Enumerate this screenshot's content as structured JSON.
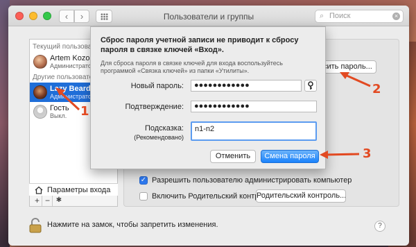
{
  "window": {
    "title": "Пользователи и группы",
    "search_placeholder": "Поиск"
  },
  "sidebar": {
    "current_section": "Текущий пользовате...",
    "current_user": {
      "name": "Artem Kozoriz",
      "role": "Администратор"
    },
    "other_section": "Другие пользовател...",
    "other_users": [
      {
        "name": "Lazy Beard",
        "role": "Администратор",
        "selected": true
      },
      {
        "name": "Гость",
        "role": "Выкл."
      }
    ],
    "login_options_label": "Параметры входа",
    "add_label": "+",
    "remove_label": "−",
    "gear_label": "✱"
  },
  "panel": {
    "reset_password_button": "сить пароль...",
    "allow_admin_label": "Разрешить пользователю администрировать компьютер",
    "allow_admin_checked": true,
    "parental_label": "Включить Родительский контроль",
    "parental_checked": false,
    "parental_button": "Родительский контроль..."
  },
  "footer": {
    "lock_text": "Нажмите на замок, чтобы запретить изменения.",
    "help_label": "?"
  },
  "sheet": {
    "title": "Сброс пароля учетной записи не приводит к сбросу пароля в связке ключей «Вход».",
    "note": "Для сброса пароля в связке ключей для входа воспользуйтесь программой «Связка ключей» из папки «Утилиты».",
    "new_password_label": "Новый пароль:",
    "new_password_value": "●●●●●●●●●●●●",
    "confirm_label": "Подтверждение:",
    "confirm_value": "●●●●●●●●●●●●",
    "hint_label": "Подсказка:",
    "hint_sublabel": "(Рекомендовано)",
    "hint_value": "n1-n2",
    "cancel_button": "Отменить",
    "submit_button": "Смена пароля"
  },
  "annotations": {
    "callout_1": "1",
    "callout_2": "2",
    "callout_3": "3",
    "arrow_color": "#e24a22"
  }
}
